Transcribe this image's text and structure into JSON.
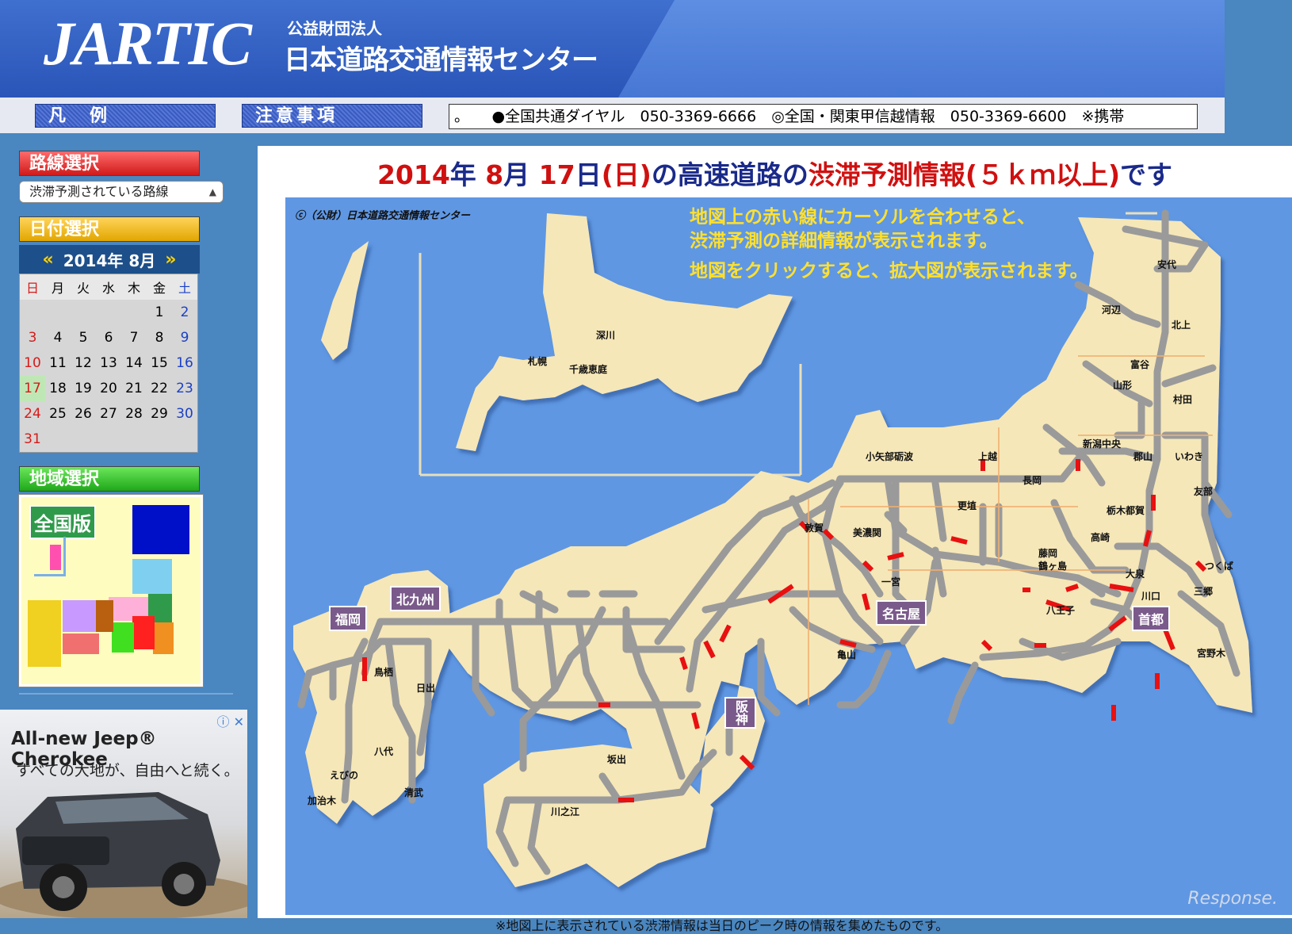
{
  "header": {
    "logo": "JARTIC",
    "org_sub": "公益財団法人",
    "org_name": "日本道路交通情報センター"
  },
  "nav": {
    "legend_button": "凡　例",
    "caution_button": "注意事項",
    "ticker": "。　　●全国共通ダイヤル　050-3369-6666　◎全国・関東甲信越情報　050-3369-6600　※携帯"
  },
  "sidebar": {
    "route_title": "路線選択",
    "route_select_value": "渋滞予測されている路線",
    "date_title": "日付選択",
    "calendar": {
      "month_label": "2014年 8月",
      "prev": "«",
      "next": "»",
      "dow": [
        "日",
        "月",
        "火",
        "水",
        "木",
        "金",
        "土"
      ],
      "weeks": [
        [
          "",
          "",
          "",
          "",
          "",
          "1",
          "2"
        ],
        [
          "3",
          "4",
          "5",
          "6",
          "7",
          "8",
          "9"
        ],
        [
          "10",
          "11",
          "12",
          "13",
          "14",
          "15",
          "16"
        ],
        [
          "17",
          "18",
          "19",
          "20",
          "21",
          "22",
          "23"
        ],
        [
          "24",
          "25",
          "26",
          "27",
          "28",
          "29",
          "30"
        ],
        [
          "31",
          "",
          "",
          "",
          "",
          "",
          ""
        ]
      ],
      "selected": "17"
    },
    "region_title": "地域選択",
    "region_map_label": "全国版"
  },
  "ad": {
    "title": "All-new Jeep® Cherokee",
    "subtitle": "すべての大地が、自由へと続く。",
    "adchoice": "ⓘ ✕"
  },
  "main": {
    "title_year": "2014",
    "title_y": "年",
    "title_month": "8",
    "title_m": "月",
    "title_day": "17",
    "title_d": "日",
    "title_weekday": "(日)",
    "title_mid": "の高速道路の",
    "title_red": "渋滞予測情報(５ｋｍ以上)",
    "title_end": "です",
    "map_copyright": "ⓒ（公財）日本道路交通情報センター",
    "note_line1": "地図上の赤い線にカーソルを合わせると、",
    "note_line2": "渋滞予測の詳細情報が表示されます。",
    "note_line3": "地図をクリックすると、拡大図が表示されます。",
    "watermark": "Response.",
    "footnote": "※地図上に表示されている渋滞情報は当日のピーク時の情報を集めたものです。"
  },
  "places": [
    {
      "id": "fukagawa",
      "label": "深川"
    },
    {
      "id": "sapporo",
      "label": "札幌"
    },
    {
      "id": "chitose",
      "label": "千歳恵庭"
    },
    {
      "id": "anshiro",
      "label": "安代"
    },
    {
      "id": "kawabe",
      "label": "河辺"
    },
    {
      "id": "kitakami",
      "label": "北上"
    },
    {
      "id": "tomiya",
      "label": "富谷"
    },
    {
      "id": "yamagata",
      "label": "山形"
    },
    {
      "id": "murata",
      "label": "村田"
    },
    {
      "id": "niigata",
      "label": "新潟中央"
    },
    {
      "id": "koriyama",
      "label": "郡山"
    },
    {
      "id": "iwaki",
      "label": "いわき"
    },
    {
      "id": "oyabe",
      "label": "小矢部砺波"
    },
    {
      "id": "joetsu",
      "label": "上越"
    },
    {
      "id": "nagaoka",
      "label": "長岡"
    },
    {
      "id": "tomobe",
      "label": "友部"
    },
    {
      "id": "sarashina",
      "label": "更埴"
    },
    {
      "id": "tochigi",
      "label": "栃木都賀"
    },
    {
      "id": "tsuruga",
      "label": "敦賀"
    },
    {
      "id": "minokamo",
      "label": "美濃関"
    },
    {
      "id": "takasaki",
      "label": "高崎"
    },
    {
      "id": "fujioka",
      "label": "藤岡"
    },
    {
      "id": "tsurugashima",
      "label": "鶴ヶ島"
    },
    {
      "id": "tsukuba",
      "label": "つくば"
    },
    {
      "id": "oizumi",
      "label": "大泉"
    },
    {
      "id": "misato",
      "label": "三郷"
    },
    {
      "id": "kawaguchi",
      "label": "川口"
    },
    {
      "id": "ichinomiya",
      "label": "一宮"
    },
    {
      "id": "hachioji",
      "label": "八王子"
    },
    {
      "id": "miyanoki",
      "label": "宮野木"
    },
    {
      "id": "kameyama",
      "label": "亀山"
    },
    {
      "id": "hiketa",
      "label": "日出"
    },
    {
      "id": "torigoe",
      "label": "鳥栖"
    },
    {
      "id": "yatsushiro",
      "label": "八代"
    },
    {
      "id": "ebino",
      "label": "えびの"
    },
    {
      "id": "kajiki",
      "label": "加治木"
    },
    {
      "id": "kiyotake",
      "label": "清武"
    },
    {
      "id": "kawanoe",
      "label": "川之江"
    },
    {
      "id": "sakaide",
      "label": "坂出"
    }
  ],
  "badges": [
    {
      "id": "fukuoka",
      "label": "福岡"
    },
    {
      "id": "kitakyushu",
      "label": "北九州"
    },
    {
      "id": "nagoya",
      "label": "名古屋"
    },
    {
      "id": "shuto",
      "label": "首都"
    },
    {
      "id": "hanshin",
      "label": "阪神"
    }
  ]
}
